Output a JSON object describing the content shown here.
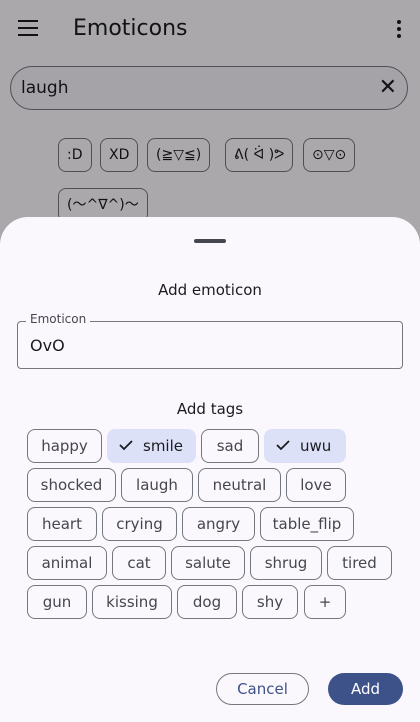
{
  "app": {
    "title": "Emoticons",
    "menu_icon": "menu-icon",
    "more_icon": "more-vert-icon"
  },
  "search": {
    "value": "laugh",
    "clear_icon": "close-icon"
  },
  "results": [
    ":D",
    "XD",
    "(≧▽≦)",
    "ᕕ( ᐛ )ᕗ",
    "⊙▽⊙",
    "(〜^∇^)〜"
  ],
  "sheet": {
    "title": "Add emoticon",
    "emoticon_label": "Emoticon",
    "emoticon_value": "OvO",
    "tags_title": "Add tags",
    "tags": [
      {
        "label": "happy",
        "selected": false
      },
      {
        "label": "smile",
        "selected": true
      },
      {
        "label": "sad",
        "selected": false
      },
      {
        "label": "uwu",
        "selected": true
      },
      {
        "label": "shocked",
        "selected": false
      },
      {
        "label": "laugh",
        "selected": false
      },
      {
        "label": "neutral",
        "selected": false
      },
      {
        "label": "love",
        "selected": false
      },
      {
        "label": "heart",
        "selected": false
      },
      {
        "label": "crying",
        "selected": false
      },
      {
        "label": "angry",
        "selected": false
      },
      {
        "label": "table_flip",
        "selected": false
      },
      {
        "label": "animal",
        "selected": false
      },
      {
        "label": "cat",
        "selected": false
      },
      {
        "label": "salute",
        "selected": false
      },
      {
        "label": "shrug",
        "selected": false
      },
      {
        "label": "tired",
        "selected": false
      },
      {
        "label": "gun",
        "selected": false
      },
      {
        "label": "kissing",
        "selected": false
      },
      {
        "label": "dog",
        "selected": false
      },
      {
        "label": "shy",
        "selected": false
      },
      {
        "label": "+",
        "selected": false
      }
    ],
    "cancel_label": "Cancel",
    "add_label": "Add"
  },
  "colors": {
    "primary": "#3d5288",
    "selected_chip": "#dde1f8",
    "scrim": "rgba(0,0,0,0.32)"
  }
}
